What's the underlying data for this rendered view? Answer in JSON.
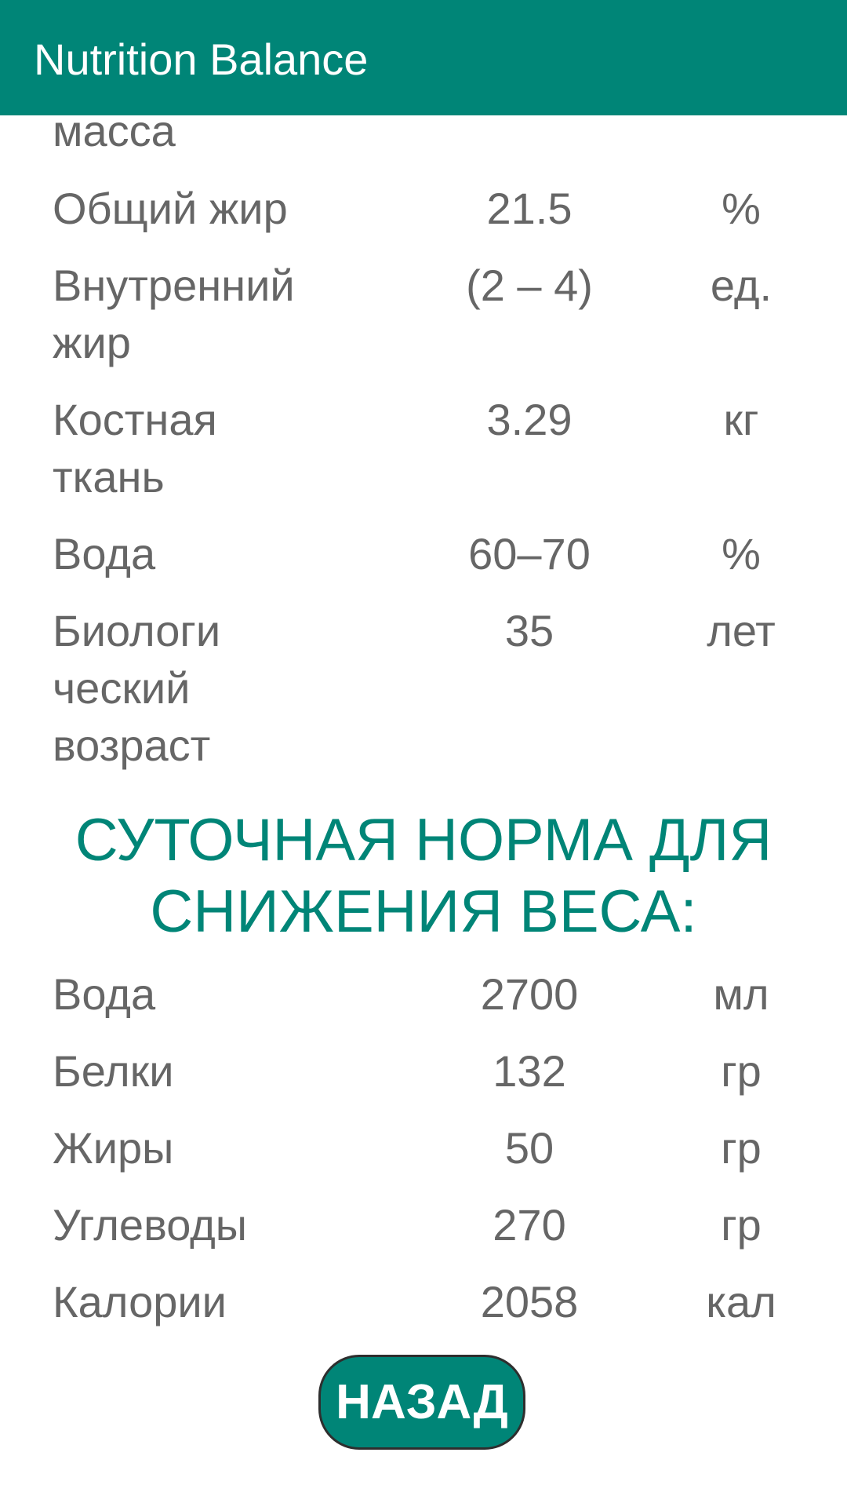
{
  "app": {
    "title": "Nutrition Balance"
  },
  "body_metrics": [
    {
      "label": "масса",
      "value": "",
      "unit": ""
    },
    {
      "label": "Общий жир",
      "value": "21.5",
      "unit": "%"
    },
    {
      "label": "Внутренний жир",
      "value": "(2 – 4)",
      "unit": "ед."
    },
    {
      "label": "Костная ткань",
      "value": "3.29",
      "unit": "кг"
    },
    {
      "label": "Вода",
      "value": "60–70",
      "unit": "%"
    },
    {
      "label": "Биологи ческий возраст",
      "value": "35",
      "unit": "лет"
    }
  ],
  "daily_norm": {
    "title": "СУТОЧНАЯ НОРМА ДЛЯ СНИЖЕНИЯ ВЕСА:",
    "rows": [
      {
        "label": "Вода",
        "value": "2700",
        "unit": "мл"
      },
      {
        "label": "Белки",
        "value": "132",
        "unit": "гр"
      },
      {
        "label": "Жиры",
        "value": "50",
        "unit": "гр"
      },
      {
        "label": "Углеводы",
        "value": "270",
        "unit": "гр"
      },
      {
        "label": "Калории",
        "value": "2058",
        "unit": "кал"
      }
    ]
  },
  "back_button": {
    "label": "НАЗАД"
  }
}
